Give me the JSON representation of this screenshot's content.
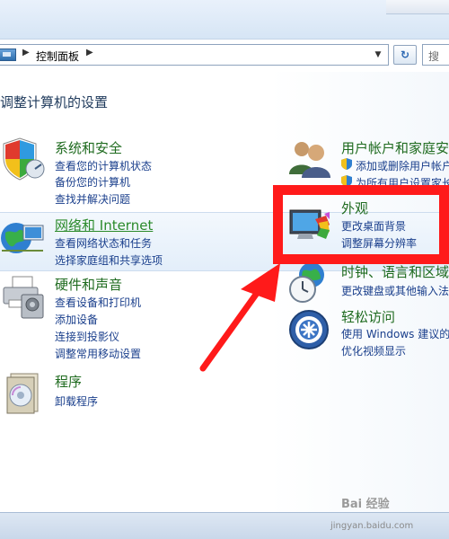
{
  "address_bar": {
    "breadcrumb": "控制面板",
    "search_placeholder": "搜"
  },
  "page": {
    "title": "调整计算机的设置"
  },
  "left_categories": [
    {
      "title": "系统和安全",
      "icon": "security-shield-icon",
      "links": [
        "查看您的计算机状态",
        "备份您的计算机",
        "查找并解决问题"
      ]
    },
    {
      "title": "网络和 Internet",
      "icon": "network-globe-icon",
      "links": [
        "查看网络状态和任务",
        "选择家庭组和共享选项"
      ]
    },
    {
      "title": "硬件和声音",
      "icon": "printer-icon",
      "links": [
        "查看设备和打印机",
        "添加设备",
        "连接到投影仪",
        "调整常用移动设置"
      ]
    },
    {
      "title": "程序",
      "icon": "programs-icon",
      "links": [
        "卸载程序"
      ]
    }
  ],
  "right_categories": [
    {
      "title": "用户帐户和家庭安",
      "icon": "user-accounts-icon",
      "links": [
        "添加或删除用户帐户",
        "为所有用户设置家长"
      ]
    },
    {
      "title": "外观",
      "icon": "appearance-monitor-icon",
      "links": [
        "更改桌面背景",
        "调整屏幕分辨率"
      ]
    },
    {
      "title": "时钟、语言和区域",
      "icon": "clock-globe-icon",
      "links": [
        "更改键盘或其他输入法"
      ]
    },
    {
      "title": "轻松访问",
      "icon": "ease-of-access-icon",
      "links": [
        "使用 Windows 建议的设",
        "优化视频显示"
      ]
    }
  ],
  "watermark": {
    "brand": "Bai 经验",
    "url": "jingyan.baidu.com"
  },
  "colors": {
    "highlight_red": "#ff1a1a",
    "category_green": "#1f6b1f",
    "link_blue": "#1a3f8c"
  }
}
